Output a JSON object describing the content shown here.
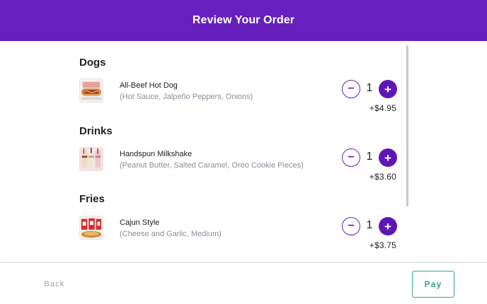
{
  "header": {
    "title": "Review Your Order",
    "background": "#6720bd"
  },
  "order": {
    "sections": [
      {
        "category": "Dogs",
        "items": [
          {
            "name": "All-Beef Hot Dog",
            "modifiers": "(Hot Sauce, Jalpeño Peppers, Onions)",
            "quantity": "1",
            "price": "+$4.95",
            "thumb": "hot-dog-thumbnail"
          }
        ]
      },
      {
        "category": "Drinks",
        "items": [
          {
            "name": "Handspun Milkshake",
            "modifiers": "(Peanut Butter, Salted Caramel, Oreo Cookie Pieces)",
            "quantity": "1",
            "price": "+$3.60",
            "thumb": "milkshake-thumbnail"
          }
        ]
      },
      {
        "category": "Fries",
        "items": [
          {
            "name": "Cajun Style",
            "modifiers": "(Cheese and Garlic, Medium)",
            "quantity": "1",
            "price": "+$3.75",
            "thumb": "fries-thumbnail"
          }
        ]
      }
    ],
    "controls": {
      "minus_symbol": "−",
      "plus_symbol": "+"
    }
  },
  "footer": {
    "back_label": "Back",
    "pay_label": "Pay",
    "pay_color": "#33a58a"
  }
}
